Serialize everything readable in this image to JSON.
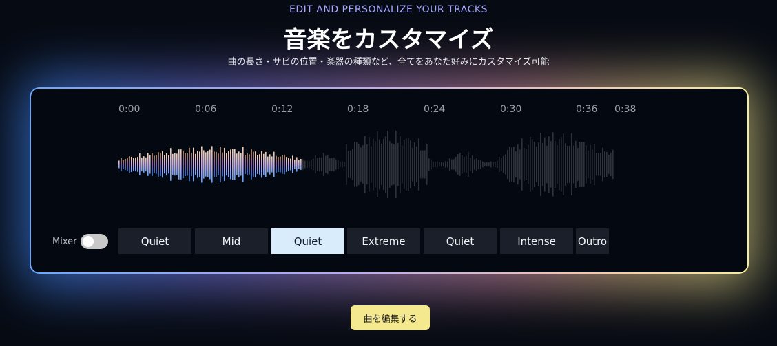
{
  "header": {
    "eyebrow": "EDIT AND PERSONALIZE YOUR TRACKS",
    "title": "音楽をカスタマイズ",
    "subtitle": "曲の長さ・サビの位置・楽器の種類など、全てをあなた好みにカスタマイズ可能"
  },
  "timeline": {
    "labels": [
      "0:00",
      "0:06",
      "0:12",
      "0:18",
      "0:24",
      "0:30",
      "0:36",
      "0:38"
    ]
  },
  "waveform": {
    "played_fraction": 0.37
  },
  "mixer": {
    "label": "Mixer",
    "enabled": false
  },
  "segments": [
    {
      "label": "Quiet",
      "active": false
    },
    {
      "label": "Mid",
      "active": false
    },
    {
      "label": "Quiet",
      "active": true
    },
    {
      "label": "Extreme",
      "active": false
    },
    {
      "label": "Quiet",
      "active": false
    },
    {
      "label": "Intense",
      "active": false
    },
    {
      "label": "Outro",
      "active": false
    }
  ],
  "cta": {
    "label": "曲を編集する"
  },
  "colors": {
    "accent_yellow": "#f5e98f",
    "active_segment": "#d9ecfb",
    "waveform_gradient_top": "#f5c9a8",
    "waveform_gradient_bottom": "#6aa8ff",
    "waveform_unplayed": "#2e323a"
  }
}
